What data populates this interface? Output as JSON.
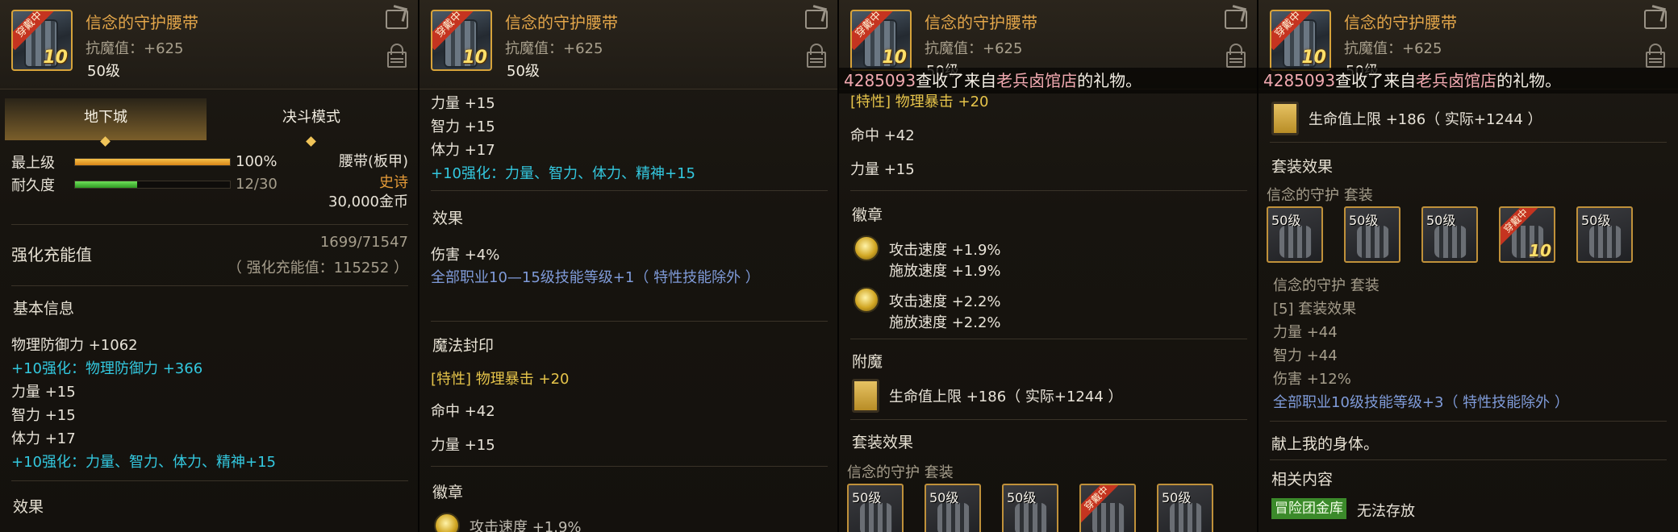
{
  "item": {
    "name": "信念的守护腰带",
    "resist": "抗魔值：+625",
    "level": "50级",
    "wear_badge": "穿戴中",
    "enhance_badge": "10"
  },
  "p1": {
    "tabs": [
      "地下城",
      "决斗模式"
    ],
    "rows": [
      {
        "label": "最上级",
        "value": "100%",
        "fill": 1.0,
        "color": "#e8a02a"
      },
      {
        "label": "耐久度",
        "value": "12/30",
        "fill": 0.4,
        "color": "#4fc23a"
      }
    ],
    "type": "腰带(板甲)",
    "rarity": "史诗",
    "price": "30,000金币",
    "charge_label": "强化充能值",
    "charge_value": "1699/71547",
    "charge_total": "（ 强化充能值：115252 ）",
    "basic_title": "基本信息",
    "lines": [
      "物理防御力 +1062",
      "+10强化：物理防御力 +366",
      "力量 +15",
      "智力 +15",
      "体力 +17",
      "+10强化：力量、智力、体力、精神+15"
    ],
    "effect_title": "效果"
  },
  "p2": {
    "lines": [
      "力量 +15",
      "智力 +15",
      "体力 +17",
      "+10强化：力量、智力、体力、精神+15"
    ],
    "effect_title": "效果",
    "effect_dmg": "伤害 +4%",
    "effect_skill": "全部职业10—15级技能等级+1（ 特性技能除外 ）",
    "seal_title": "魔法封印",
    "seal_crit": "[特性] 物理暴击 +20",
    "seal_hit": "命中 +42",
    "seal_str": "力量 +15",
    "emblem_title": "徽章",
    "emblem_partial": "攻击速度 +1.9%"
  },
  "gift": {
    "num": "4285093",
    "pre": "查收了来自",
    "shop": "老兵卤馆店",
    "post": "的礼物。"
  },
  "p3": {
    "crit_partial": "[特性] 物理暴击 +20",
    "hit": "命中 +42",
    "str": "力量 +15",
    "emblem_title": "徽章",
    "emblem1": [
      "攻击速度 +1.9%",
      "施放速度 +1.9%"
    ],
    "emblem2": [
      "攻击速度 +2.2%",
      "施放速度 +2.2%"
    ],
    "enchant_title": "附魔",
    "enchant": "生命值上限 +186（ 实际+1244 ）",
    "set_title": "套装效果",
    "set_name": "信念的守护  套装",
    "set_levels": [
      "50级",
      "50级",
      "50级",
      "",
      "50级"
    ]
  },
  "p4": {
    "enchant": "生命值上限 +186（ 实际+1244 ）",
    "set_title": "套装效果",
    "set_name": "信念的守护  套装",
    "set_levels": [
      "50级",
      "50级",
      "50级",
      "",
      "50级"
    ],
    "set_name2": "信念的守护  套装",
    "set_bonus": "[5] 套装效果",
    "bonus_lines": [
      "力量 +44",
      "智力 +44",
      "伤害 +12%"
    ],
    "bonus_skill": "全部职业10级技能等级+3（ 特性技能除外 ）",
    "flavor": "献上我的身体。",
    "related_title": "相关内容",
    "vault_tag": "冒险团金库",
    "vault_text": "无法存放"
  }
}
